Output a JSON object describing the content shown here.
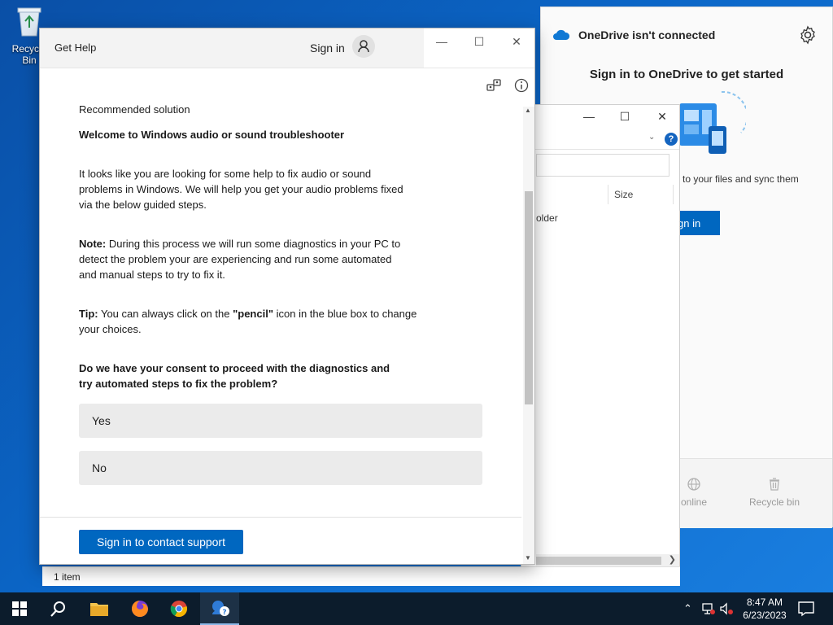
{
  "desktop": {
    "recycle_bin_label": "Recycle Bin"
  },
  "onedrive": {
    "header": "OneDrive isn't connected",
    "title": "Sign in to OneDrive to get started",
    "description": "to your files and sync them",
    "signin_label": "gn in",
    "footer_online": "online",
    "footer_recycle": "Recycle bin",
    "accent": "#0067c0"
  },
  "explorer": {
    "column_size": "Size",
    "folder_text": "older",
    "status": "1 item"
  },
  "gethelp": {
    "app_name": "Get Help",
    "sign_in": "Sign in",
    "recommended": "Recommended solution",
    "welcome": "Welcome to Windows audio or sound troubleshooter",
    "intro": [
      "It looks like you are looking for some help to fix audio or sound",
      "problems in Windows. We will help you get your audio problems fixed",
      "via the below guided steps."
    ],
    "note_label": "Note:",
    "note_lines": [
      " During this process we will run some diagnostics in your PC to",
      "detect the problem your are experiencing and run some automated",
      " and manual steps to try to fix it."
    ],
    "tip_label": "Tip:",
    "tip_before": " You can always click on the ",
    "tip_bold": "\"pencil\"",
    "tip_after": " icon in the blue box to change",
    "tip_line2": "your choices.",
    "consent": [
      "Do we have your consent to proceed with the diagnostics and",
      "try automated steps to fix the problem?"
    ],
    "yes_label": "Yes",
    "no_label": "No",
    "contact_label": "Sign in to contact support",
    "accent": "#0067c0"
  },
  "taskbar": {
    "time": "8:47 AM",
    "date": "6/23/2023"
  }
}
